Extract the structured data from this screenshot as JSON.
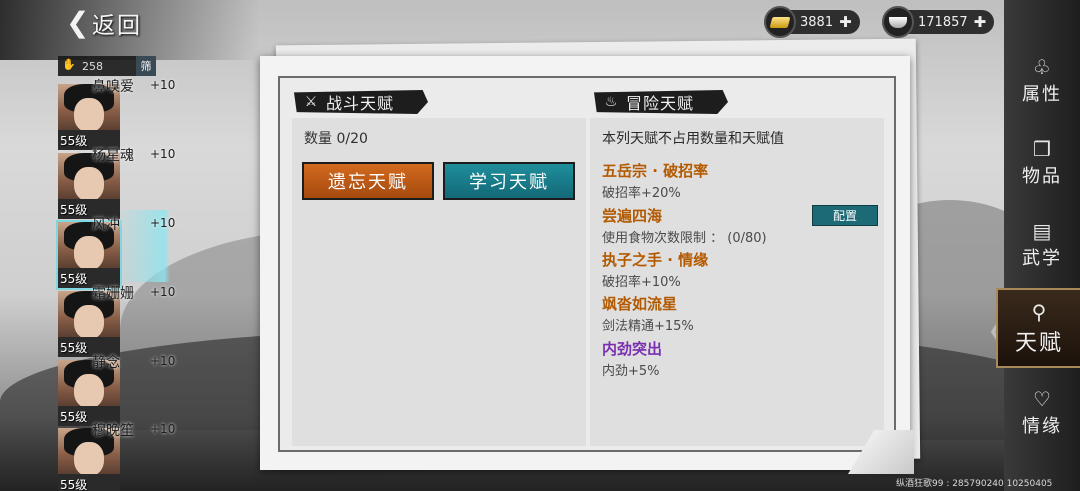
{
  "header": {
    "back_label": "返回",
    "gold_amount": "3881",
    "silver_amount": "171857"
  },
  "hero_list": {
    "count": "258",
    "filter_label": "筛",
    "heroes": [
      {
        "name": "鼻嗅爱",
        "bonus": "+10",
        "level": "55级"
      },
      {
        "name": "杨星魂",
        "bonus": "+10",
        "level": "55级"
      },
      {
        "name": "风冲",
        "bonus": "+10",
        "level": "55级"
      },
      {
        "name": "霜姗姗",
        "bonus": "+10",
        "level": "55级"
      },
      {
        "name": "静念",
        "bonus": "+10",
        "level": "55级"
      },
      {
        "name": "穆晚笙",
        "bonus": "+10",
        "level": "55级"
      }
    ]
  },
  "combat": {
    "title": "战斗天赋",
    "count_line": "数量 0/20",
    "forget_label": "遗忘天赋",
    "learn_label": "学习天赋"
  },
  "adventure": {
    "title": "冒险天赋",
    "note": "本列天赋不占用数量和天赋值",
    "config_label": "配置",
    "talents": [
      {
        "title": "五岳宗 · 破招率",
        "desc": "破招率+20%",
        "color": "#b35a00"
      },
      {
        "title": "尝遍四海",
        "desc": "使用食物次数限制 ：   (0/80)",
        "color": "#b35a00"
      },
      {
        "title": "执子之手 · 情缘",
        "desc": "破招率+10%",
        "color": "#b35a00"
      },
      {
        "title": "飒沓如流星",
        "desc": "剑法精通+15%",
        "color": "#b35a00"
      },
      {
        "title": "内劲突出",
        "desc": "内劲+5%",
        "color": "#7a2fb0"
      }
    ]
  },
  "tabs": [
    {
      "label": "属性",
      "icon": "pouch-icon"
    },
    {
      "label": "物品",
      "icon": "box-icon"
    },
    {
      "label": "武学",
      "icon": "book-icon"
    },
    {
      "label": "天赋",
      "icon": "talent-tree-icon"
    },
    {
      "label": "情缘",
      "icon": "heart-icon"
    }
  ],
  "footer": {
    "id_text": "纵酒狂歌99 : 285790240  10250405"
  }
}
